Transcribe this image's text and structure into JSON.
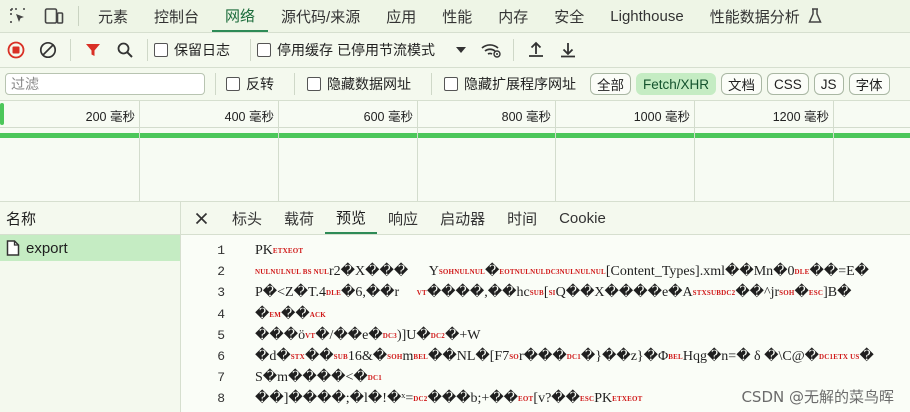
{
  "devtools_tabs": [
    "元素",
    "控制台",
    "网络",
    "源代码/来源",
    "应用",
    "性能",
    "内存",
    "安全",
    "Lighthouse",
    "性能数据分析"
  ],
  "active_tab": "网络",
  "toolbar": {
    "preserve_log": "保留日志",
    "disable_cache": "停用缓存",
    "throttling": "已停用节流模式"
  },
  "filter": {
    "placeholder": "过滤",
    "invert": "反转",
    "hide_data_urls": "隐藏数据网址",
    "hide_extension_urls": "隐藏扩展程序网址",
    "types": [
      "全部",
      "Fetch/XHR",
      "文档",
      "CSS",
      "JS",
      "字体"
    ],
    "active_type": "Fetch/XHR"
  },
  "timeline_ticks": [
    "200 毫秒",
    "400 毫秒",
    "600 毫秒",
    "800 毫秒",
    "1000 毫秒",
    "1200 毫秒"
  ],
  "request_list": {
    "header": "名称",
    "items": [
      "export"
    ]
  },
  "detail_tabs": [
    "标头",
    "载荷",
    "预览",
    "响应",
    "启动器",
    "时间",
    "Cookie"
  ],
  "active_detail_tab": "预览",
  "preview_lines": [
    {
      "n": "1",
      "parts": [
        [
          "t",
          "PK"
        ],
        [
          "c",
          "ETXEOT"
        ]
      ]
    },
    {
      "n": "2",
      "parts": [
        [
          "c",
          "NULNULNUL BS NUL"
        ],
        [
          "t",
          "r2�X���      "
        ],
        [
          "t",
          "Y"
        ],
        [
          "c",
          "SOHNULNUL"
        ],
        [
          "t",
          "�"
        ],
        [
          "c",
          "EOTNULNULDC3NULNULNUL"
        ],
        [
          "t",
          "[Content_Types].xml��Mn�0"
        ],
        [
          "c",
          "DLE"
        ],
        [
          "t",
          "��=E�"
        ]
      ]
    },
    {
      "n": "3",
      "parts": [
        [
          "t",
          "P�<Z�T.4"
        ],
        [
          "c",
          "DLE"
        ],
        [
          "t",
          "�6,��r     "
        ],
        [
          "c",
          "VT"
        ],
        [
          "t",
          "����,��hc"
        ],
        [
          "c",
          "SUB"
        ],
        [
          "t",
          "["
        ],
        [
          "c",
          "SI"
        ],
        [
          "t",
          "Q��X����e�A"
        ],
        [
          "c",
          "STXSUBDC2"
        ],
        [
          "t",
          "��^jr"
        ],
        [
          "c",
          "SOH"
        ],
        [
          "t",
          "�"
        ],
        [
          "c",
          "ESC"
        ],
        [
          "t",
          "]B�"
        ]
      ]
    },
    {
      "n": "4",
      "parts": [
        [
          "t",
          "�"
        ],
        [
          "c",
          "EM"
        ],
        [
          "t",
          "��"
        ],
        [
          "c",
          "ACK"
        ]
      ]
    },
    {
      "n": "5",
      "parts": [
        [
          "t",
          "���ö"
        ],
        [
          "c",
          "VT"
        ],
        [
          "t",
          "�/��e�"
        ],
        [
          "c",
          "DC3"
        ],
        [
          "t",
          ")]U�"
        ],
        [
          "c",
          "DC2"
        ],
        [
          "t",
          "�+W"
        ]
      ]
    },
    {
      "n": "6",
      "parts": [
        [
          "t",
          "�d�"
        ],
        [
          "c",
          "STX"
        ],
        [
          "t",
          "��"
        ],
        [
          "c",
          "SUB"
        ],
        [
          "t",
          "16&�"
        ],
        [
          "c",
          "SOH"
        ],
        [
          "t",
          "m"
        ],
        [
          "c",
          "BEL"
        ],
        [
          "t",
          "��NL�[F7"
        ],
        [
          "c",
          "SO"
        ],
        [
          "t",
          "r���"
        ],
        [
          "c",
          "DC1"
        ],
        [
          "t",
          "�}��z}�Φ"
        ],
        [
          "c",
          "BEL"
        ],
        [
          "t",
          "Hqg�n=� δ �\\C@�"
        ],
        [
          "c",
          "DC1ETX US"
        ],
        [
          "t",
          "�"
        ]
      ]
    },
    {
      "n": "7",
      "parts": [
        [
          "t",
          "S�m����<�"
        ],
        [
          "c",
          "DC1"
        ]
      ]
    },
    {
      "n": "8",
      "parts": [
        [
          "t",
          "��]����;�l�!�ˣ="
        ],
        [
          "c",
          "DC2"
        ],
        [
          "t",
          "���b;+��"
        ],
        [
          "c",
          "EOT"
        ],
        [
          "t",
          "[v?��"
        ],
        [
          "c",
          "ESC"
        ],
        [
          "t",
          "PK"
        ],
        [
          "c",
          "ETXEOT"
        ]
      ]
    }
  ],
  "watermark": "CSDN @无解的菜鸟晖",
  "colors": {
    "record_stop": "#d93025",
    "filter_red": "#d93025",
    "accent_green": "#2e8b57",
    "timeline_green": "#4cc75a"
  }
}
